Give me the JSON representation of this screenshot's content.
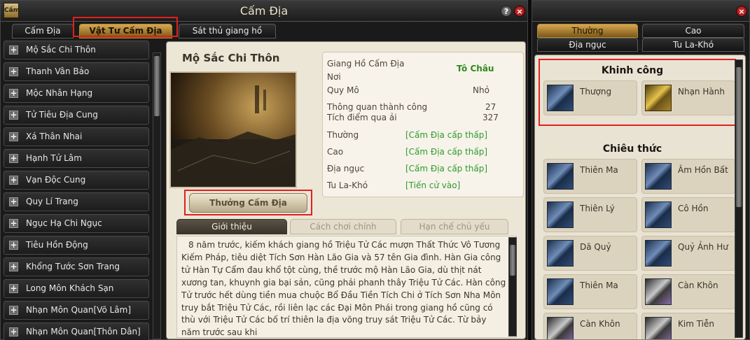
{
  "left_window": {
    "title": "Cấm Địa",
    "icon_text": "Cấm",
    "tabs": [
      "Cấm Địa",
      "Vật Tư Cấm Địa",
      "Sát thủ giang hồ"
    ],
    "active_tab": "Vật Tư Cấm Địa",
    "list": [
      "Mộ Sắc Chi Thôn",
      "Thanh Vân Bảo",
      "Mộc Nhân Hạng",
      "Tử Tiêu Địa Cung",
      "Xá Thân Nhai",
      "Hạnh Tử Lâm",
      "Vạn Độc Cung",
      "Quy Lí Trang",
      "Ngục Hạ Chi Ngục",
      "Tiêu Hồn Động",
      "Khổng Tước Sơn Trang",
      "Long Môn Khách Sạn",
      "Nhạn Môn Quan[Võ Lâm]",
      "Nhạn Môn Quan[Thôn Dân]"
    ],
    "map_name": "Mộ Sắc Chi Thôn",
    "reward_button": "Thưởng Cấm Địa",
    "info": {
      "location_label": "Giang Hồ Cấm Địa",
      "location_label2": "Nơi",
      "location_value": "Tô Châu",
      "scale_label": "Quy Mô",
      "scale_value": "Nhỏ",
      "success_label": "Thông quan thành công",
      "success_value": "27",
      "points_label": "Tích điểm qua ải",
      "points_value": "327",
      "difficulties": [
        {
          "label": "Thường",
          "value": "[Cấm Địa cấp thấp]"
        },
        {
          "label": "Cao",
          "value": "[Cấm Địa cấp thấp]"
        },
        {
          "label": "Địa ngục",
          "value": "[Cấm Địa cấp thấp]"
        },
        {
          "label": "Tu La-Khó",
          "value": "[Tiến cử vào]"
        }
      ]
    },
    "subtabs": [
      "Giới thiệu",
      "Cách chơi chính",
      "Hạn chế chủ yếu"
    ],
    "description": "8 năm trước, kiếm khách giang hồ Triệu Tử Các mượn Thất Thức Vô Tương Kiếm Pháp, tiêu diệt Tích Sơn Hàn Lão Gia và 57 tên Gia đình. Hàn Gia công tử Hàn Tự Cẩm đau khổ tột cùng, thề trước mộ Hàn Lão Gia, dù thịt nát xương tan, khuynh gia bại sản, cũng phải phanh thây Triệu Tử Các. Hàn công Tử trước hết dùng tiền mua chuộc Bổ Đầu Tiền Tích Chi ở Tích Sơn Nha Môn truy bắt Triệu Tử Các, rồi liên lạc các Đại Môn Phái trong giang hồ cũng có thù với Triệu Tử Các bố trí thiên la địa võng truy sát Triệu Tử Các. Từ bảy năm trước sau khi"
  },
  "right_window": {
    "tabs": [
      "Thường",
      "Cao",
      "Địa ngục",
      "Tu La-Khó"
    ],
    "active_tab": "Thường",
    "section1_title": "Khinh công",
    "section1_items": [
      "Thượng",
      "Nhạn Hành"
    ],
    "section2_title": "Chiêu thức",
    "section2_items": [
      "Thiên Ma",
      "Âm Hồn Bất",
      "Thiên Lý",
      "Cô Hồn",
      "Dã Quỷ",
      "Quỷ Ảnh Hư",
      "Thiên Ma",
      "Càn Khôn",
      "Càn Khôn",
      "Kim Tiễn"
    ]
  },
  "colors": {
    "accent_gold": "#d8a850",
    "highlight_red": "#e2201e",
    "green_text": "#2e9a2e"
  }
}
